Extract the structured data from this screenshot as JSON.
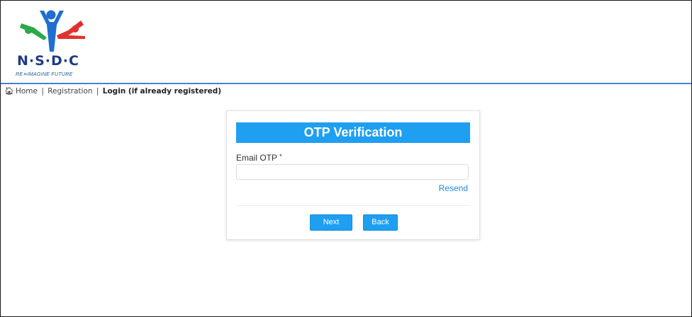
{
  "brand": {
    "logo_text": "N·S·D·C",
    "tagline": "RE⋗IMAGINE FUTURE",
    "colors": {
      "green": "#2ca84a",
      "blue": "#1e6fd0",
      "red": "#e0312f",
      "navy": "#1e3a8a"
    }
  },
  "breadcrumb": {
    "home_icon": "home-icon",
    "home": "Home",
    "registration": "Registration",
    "separator": "|",
    "current": "Login (if already registered)"
  },
  "form": {
    "title": "OTP Verification",
    "email_otp_label": "Email OTP",
    "required_marker": "*",
    "email_otp_value": "",
    "resend_label": "Resend",
    "next_label": "Next",
    "back_label": "Back",
    "accent_color": "#1e9ff2"
  }
}
